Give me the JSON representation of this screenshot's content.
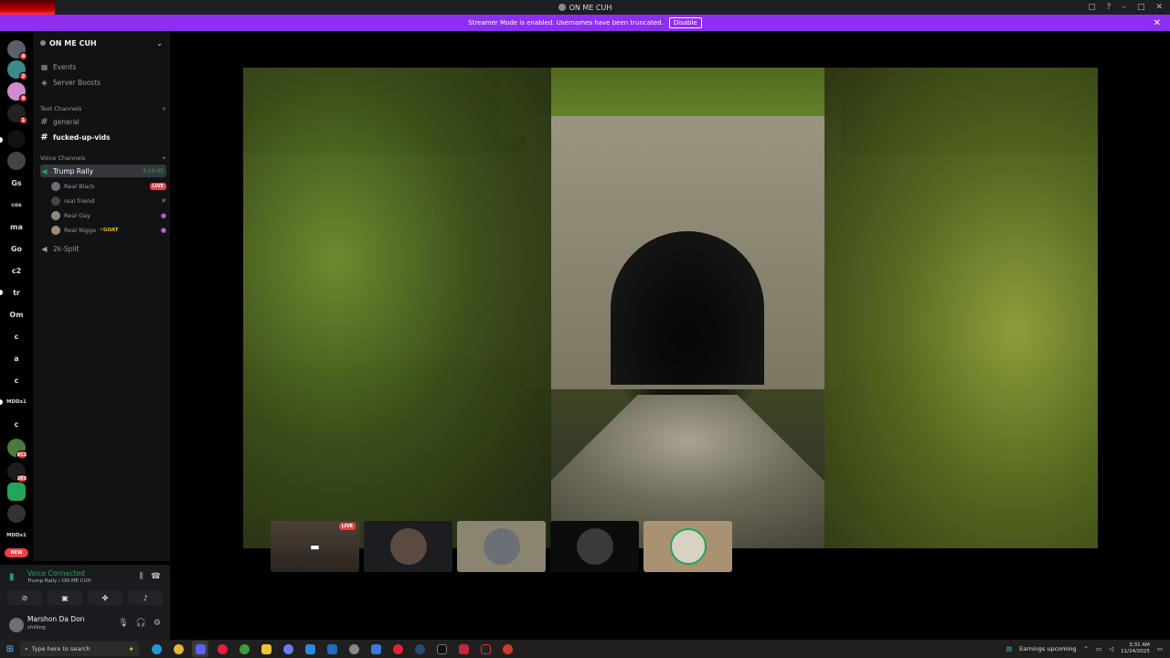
{
  "window": {
    "title": "ON ME CUH",
    "controls": [
      "▢",
      "?",
      "–",
      "□",
      "✕"
    ]
  },
  "banner": {
    "text": "Streamer Mode is enabled. Usernames have been truncated.",
    "button": "Disable",
    "close": "✕"
  },
  "rail": {
    "text_servers": [
      "Gs",
      "cos",
      "ma",
      "Go",
      "c2",
      "tr",
      "Om",
      "c",
      "a",
      "c",
      "MDDs1",
      "c",
      "MDDs1"
    ],
    "badges": [
      "4",
      "2",
      "4",
      "1",
      "912",
      "203"
    ],
    "new_label": "NEW"
  },
  "server": {
    "name": "ON ME CUH",
    "chevron": "⌄",
    "events": "Events",
    "boosts": "Server Boosts"
  },
  "text_channels": {
    "label": "Text Channels",
    "add": "+",
    "items": [
      "general",
      "fucked-up-vids"
    ]
  },
  "voice_channels": {
    "label": "Voice Channels",
    "add": "+",
    "active": {
      "name": "Trump Rally",
      "time": "4:19:05"
    },
    "users": [
      {
        "name": "Real Black",
        "tag": "LIVE"
      },
      {
        "name": "real friend",
        "tag": ""
      },
      {
        "name": "Real Gay",
        "tag": ""
      },
      {
        "name": "Real Nigga",
        "tag": "⚡GOAT"
      }
    ],
    "other": "2k-Split"
  },
  "voice_panel": {
    "status": "Voice Connected",
    "channel": "Trump Rally / ON ME CUH"
  },
  "user": {
    "name": "Marshon Da Don",
    "status": "chilling"
  },
  "thumbs": {
    "live": "LIVE"
  },
  "taskbar": {
    "search_placeholder": "Type here to search",
    "news": "Earnings upcoming",
    "time": "3:31 AM",
    "date": "11/24/2025"
  },
  "colors": {
    "banner": "#8d2ff1",
    "online": "#23a559",
    "live": "#f23f43",
    "sidebar": "#111214"
  }
}
